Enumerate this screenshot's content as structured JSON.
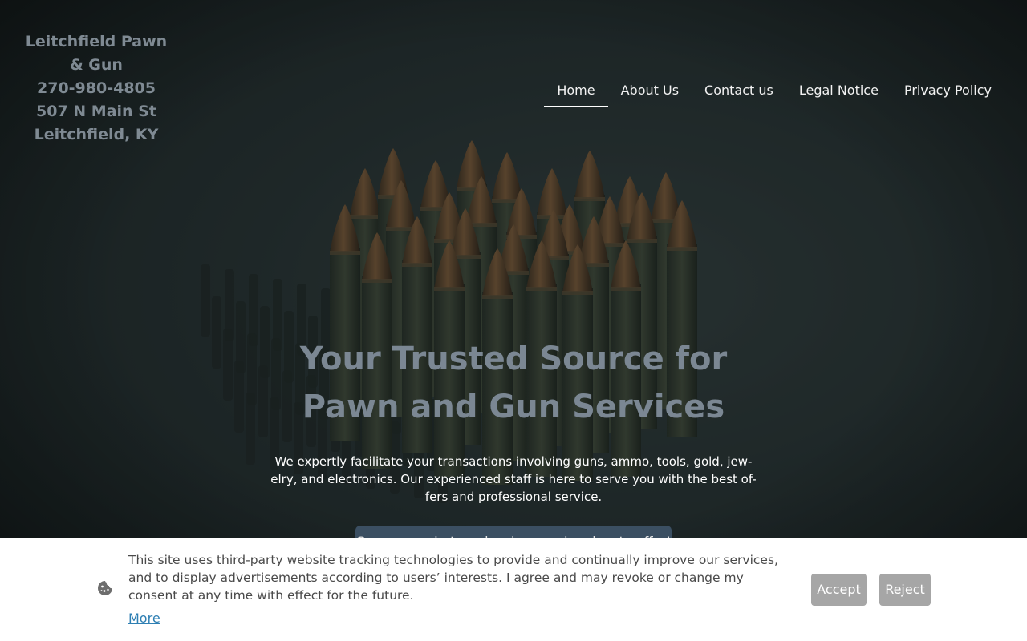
{
  "header": {
    "logo_lines": [
      "Leitchfield Pawn",
      "& Gun",
      "270-980-4805",
      "507 N Main St",
      "Leitchfield, KY"
    ]
  },
  "nav": {
    "items": [
      {
        "label": "Home",
        "active": true
      },
      {
        "label": "About Us",
        "active": false
      },
      {
        "label": "Contact us",
        "active": false
      },
      {
        "label": "Legal Notice",
        "active": false
      },
      {
        "label": "Privacy Policy",
        "active": false
      }
    ]
  },
  "hero": {
    "background": "ammunition-cartridges-photo",
    "headline_line1": "Your Trusted Source for",
    "headline_line2": "Pawn and Gun Services",
    "lead": "We expertly facilitate your transactions involving guns, ammo, tools, gold, jew-elry, and electronics. Our experienced staff is here to serve you with the best of-fers and professional service.",
    "cta_label": "Come see what our local pawn shop has to offer!"
  },
  "cookie_banner": {
    "icon": "cookie-icon",
    "text": "This site uses third-party website tracking technologies to provide and continually improve our services, and to display advertisements according to users’ interests. I agree and may revoke or change my consent at any time with effect for the future.",
    "more_label": "More",
    "accept_label": "Accept",
    "reject_label": "Reject"
  },
  "colors": {
    "logo_text": "#7f8a93",
    "headline_text": "#7b8793",
    "cta_background": "#3b4f62",
    "cookie_button": "#a6a6a6",
    "link": "#2e7fb3"
  }
}
